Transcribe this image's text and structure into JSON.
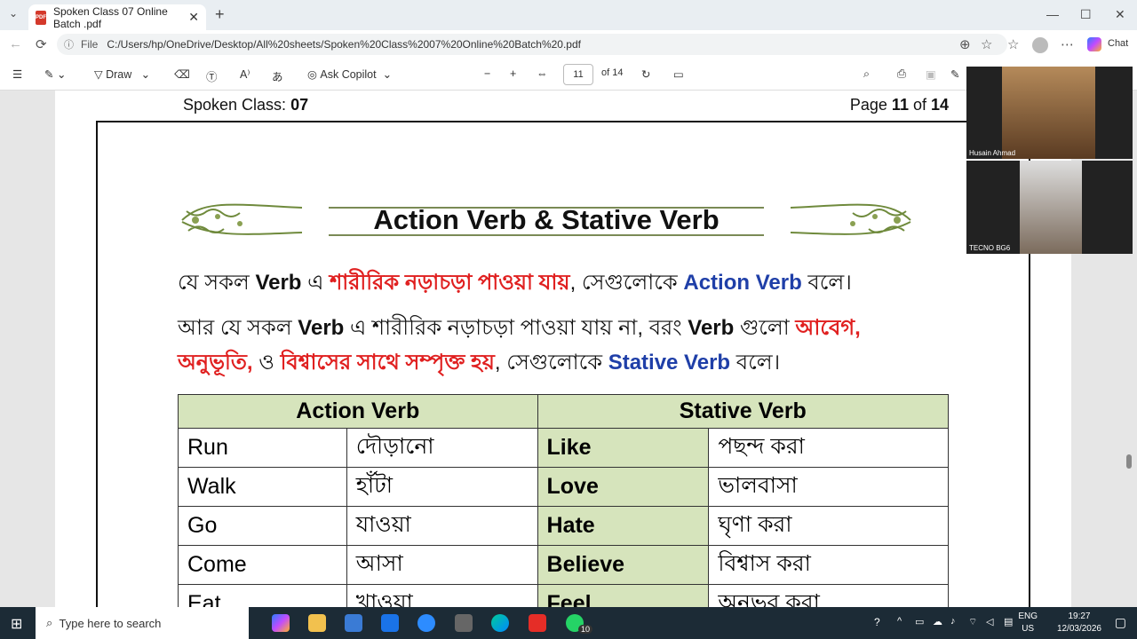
{
  "browser": {
    "tab_title": "Spoken Class 07 Online Batch .pdf",
    "file_label": "File",
    "url": "C:/Users/hp/OneDrive/Desktop/All%20sheets/Spoken%20Class%2007%20Online%20Batch%20.pdf",
    "chat_label": "Chat"
  },
  "pdf_toolbar": {
    "draw_label": "Draw",
    "copilot_label": "Ask Copilot",
    "page_current": "11",
    "page_total": "of 14"
  },
  "page": {
    "header_left_prefix": "Spoken Class: ",
    "header_left_num": "07",
    "header_right_prefix": "Page ",
    "header_right_num": "11",
    "header_right_mid": " of ",
    "header_right_total": "14",
    "banner_title": "Action Verb & Stative Verb",
    "para1": {
      "a": "যে সকল ",
      "b": "Verb",
      "c": " এ ",
      "d": "শারীরিক নড়াচড়া পাওয়া যায়",
      "e": ", সেগুলোকে ",
      "f": "Action Verb",
      "g": " বলে।"
    },
    "para2_line1": {
      "a": "আর যে সকল ",
      "b": "Verb",
      "c": " এ শারীরিক নড়াচড়া পাওয়া যায় না, বরং ",
      "d": "Verb",
      "e": " গুলো ",
      "f": "আবেগ,"
    },
    "para2_line2": {
      "a": "অনুভূতি,",
      "b": " ও ",
      "c": "বিশ্বাসের সাথে সম্পৃক্ত হয়",
      "d": ", সেগুলোকে ",
      "e": "Stative Verb",
      "f": " বলে।"
    },
    "table": {
      "col_action": "Action Verb",
      "col_stative": "Stative Verb",
      "rows": [
        {
          "action": "Run",
          "action_bn": "দৌড়ানো",
          "stative": "Like",
          "stative_bn": "পছন্দ করা"
        },
        {
          "action": "Walk",
          "action_bn": "হাঁটা",
          "stative": "Love",
          "stative_bn": "ভালবাসা"
        },
        {
          "action": "Go",
          "action_bn": "যাওয়া",
          "stative": "Hate",
          "stative_bn": "ঘৃণা করা"
        },
        {
          "action": "Come",
          "action_bn": "আসা",
          "stative": "Believe",
          "stative_bn": "বিশ্বাস করা"
        },
        {
          "action": "Eat",
          "action_bn": "খাওয়া",
          "stative": "Feel",
          "stative_bn": "অনুভব করা"
        }
      ]
    }
  },
  "video_tiles": [
    {
      "name": "Husain Ahmad"
    },
    {
      "name": "TECNO BG6"
    }
  ],
  "taskbar": {
    "search_placeholder": "Type here to search",
    "lang_top": "ENG",
    "lang_bottom": "US",
    "time": "19:27",
    "date": "12/03/2026",
    "whatsapp_badge": "10"
  },
  "colors": {
    "accent_red": "#e02020",
    "accent_blue": "#1f3fa8",
    "table_header_green": "#d6e4bc"
  }
}
